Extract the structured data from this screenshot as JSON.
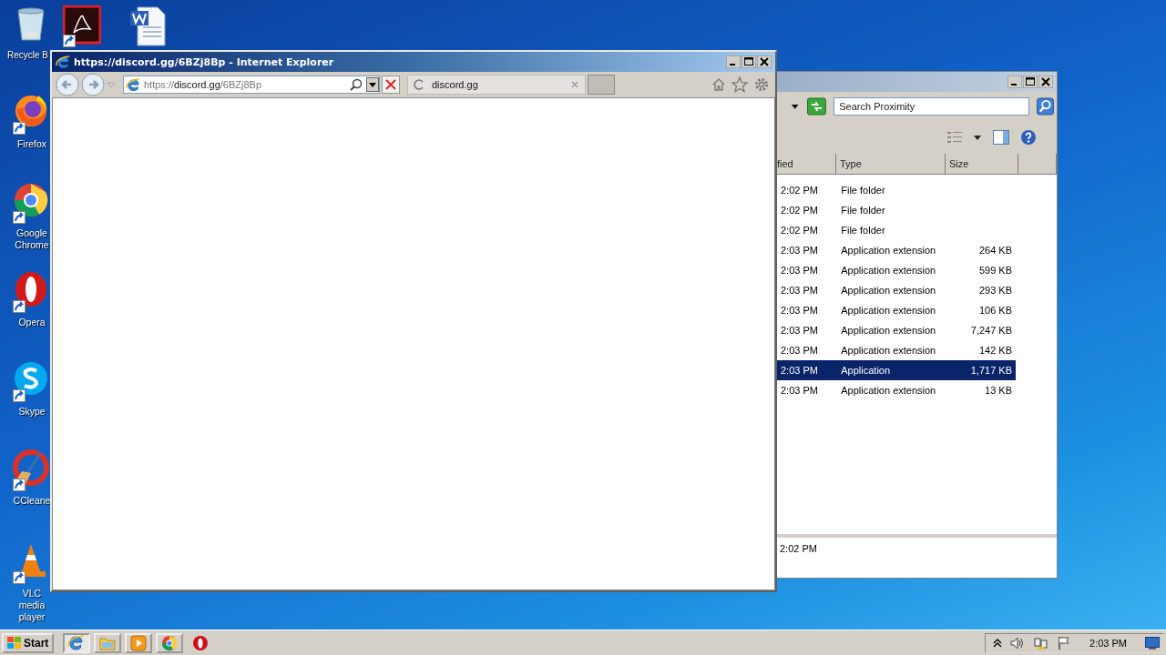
{
  "desktop_icons": [
    {
      "kind": "recycle",
      "label": "Recycle B"
    },
    {
      "kind": "acrobat"
    },
    {
      "kind": "word"
    },
    {
      "kind": "firefox",
      "label": "Firefox"
    },
    {
      "kind": "chrome",
      "label": "Google Chrome"
    },
    {
      "kind": "opera",
      "label": "Opera"
    },
    {
      "kind": "skype",
      "label": "Skype"
    },
    {
      "kind": "ccleaner",
      "label": "CCleane"
    },
    {
      "kind": "vlc",
      "label": "VLC media player"
    }
  ],
  "explorer_window": {
    "search": {
      "placeholder": "Search Proximity"
    },
    "columns": [
      "fied",
      "Type",
      "Size"
    ],
    "rows": [
      {
        "modified": "2:02 PM",
        "type": "File folder",
        "selected": false
      },
      {
        "modified": "2:02 PM",
        "type": "File folder",
        "selected": false
      },
      {
        "modified": "2:02 PM",
        "type": "File folder",
        "selected": false
      },
      {
        "modified": "2:03 PM",
        "type": "Application extension",
        "size": "264 KB",
        "selected": false
      },
      {
        "modified": "2:03 PM",
        "type": "Application extension",
        "size": "599 KB",
        "selected": false
      },
      {
        "modified": "2:03 PM",
        "type": "Application extension",
        "size": "293 KB",
        "selected": false
      },
      {
        "modified": "2:03 PM",
        "type": "Application extension",
        "size": "106 KB",
        "selected": false
      },
      {
        "modified": "2:03 PM",
        "type": "Application extension",
        "size": "7,247 KB",
        "selected": false
      },
      {
        "modified": "2:03 PM",
        "type": "Application extension",
        "size": "142 KB",
        "selected": false
      },
      {
        "modified": "2:03 PM",
        "type": "Application",
        "size": "1,717 KB",
        "selected": true
      },
      {
        "modified": "2:03 PM",
        "type": "Application extension",
        "size": "13 KB",
        "selected": false
      }
    ],
    "details": "2:02 PM"
  },
  "ie_window": {
    "title": "https://discord.gg/6BZj8Bp - Internet Explorer",
    "address": {
      "scheme": "https://",
      "domain": "discord.gg",
      "path": "/6BZj8Bp"
    },
    "tab": {
      "label": "discord.gg",
      "loading": true
    }
  },
  "taskbar": {
    "start": "Start",
    "apps": [
      {
        "kind": "ie",
        "active": true
      },
      {
        "kind": "explorer",
        "active": false
      },
      {
        "kind": "media",
        "active": false
      },
      {
        "kind": "chrome",
        "active": false
      },
      {
        "kind": "opera",
        "active": false
      }
    ],
    "clock": "2:03 PM"
  }
}
